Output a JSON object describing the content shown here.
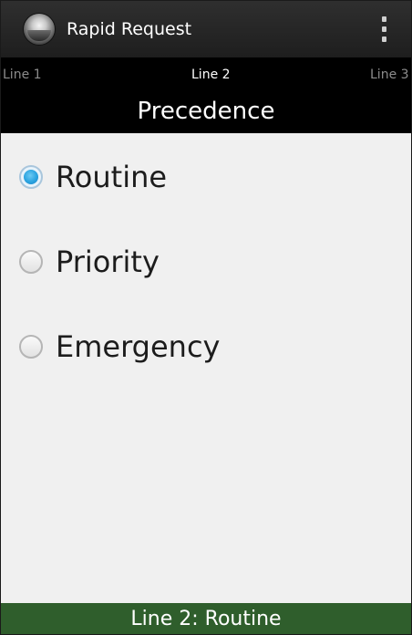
{
  "action_bar": {
    "app_icon": "app-logo-icon",
    "title": "Rapid Request",
    "overflow_icon": "overflow-menu-icon"
  },
  "tabs": [
    {
      "label": "Line 1",
      "selected": false
    },
    {
      "label": "Line 2",
      "selected": true
    },
    {
      "label": "Line 3",
      "selected": false
    }
  ],
  "section": {
    "title": "Precedence"
  },
  "options": [
    {
      "label": "Routine",
      "checked": true
    },
    {
      "label": "Priority",
      "checked": false
    },
    {
      "label": "Emergency",
      "checked": false
    }
  ],
  "footer": {
    "status": "Line 2: Routine"
  },
  "colors": {
    "action_bar": "#262626",
    "tab_strip": "#000000",
    "content_bg": "#f0f0f0",
    "radio_accent": "#2aa3e0",
    "footer_bg": "#2f5e2c"
  }
}
